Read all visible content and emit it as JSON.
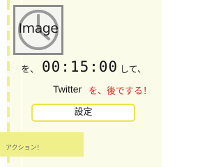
{
  "image_placeholder": {
    "label": "Image",
    "icon": "clock-icon"
  },
  "sentence": {
    "particle_wo": "を、",
    "time": "00:15:00",
    "particle_shite": "して、",
    "service": "Twitter",
    "action_message": "を、後でする！"
  },
  "settings_button": {
    "label": "設定"
  },
  "action_panel": {
    "label": "アクション！"
  },
  "colors": {
    "paper": "#fbfbea",
    "accent_yellow": "#e8e64a",
    "highlight_red": "#e0231b",
    "panel_yellow": "#f0f08a"
  }
}
